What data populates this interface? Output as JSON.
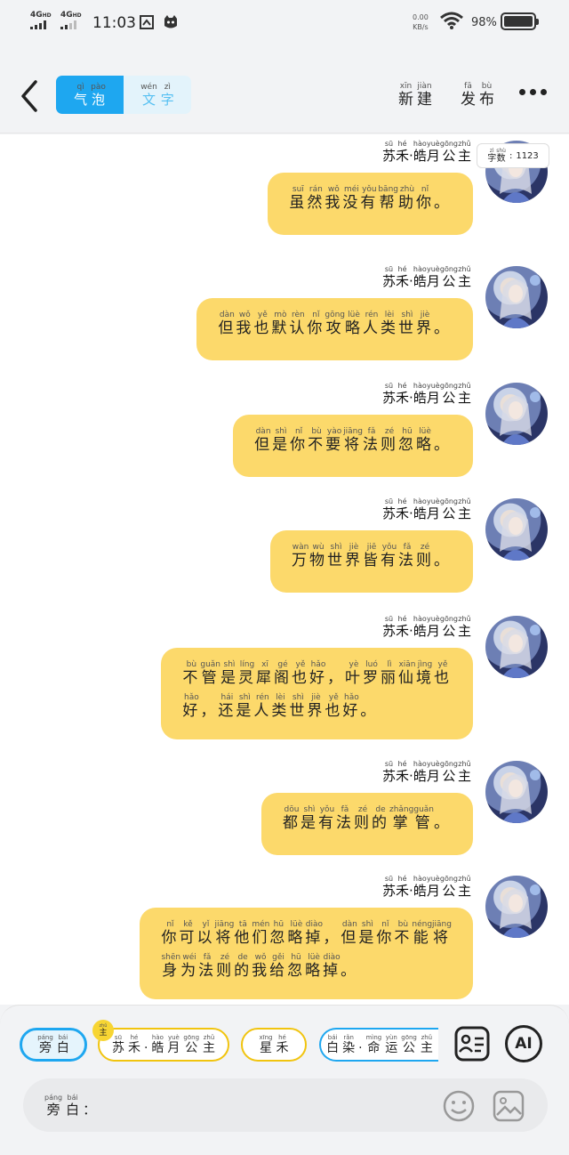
{
  "status": {
    "net1": "4G",
    "net2": "4G",
    "time": "11:03",
    "speed_value": "0.00",
    "speed_unit": "KB/s",
    "battery": "98%"
  },
  "header": {
    "tab_bubble": {
      "text": "气泡",
      "pinyin": [
        "qì",
        "pào"
      ]
    },
    "tab_text": {
      "text": "文字",
      "pinyin": [
        "wén",
        "zì"
      ]
    },
    "new_button": {
      "text": "新建",
      "pinyin": [
        "xīn",
        "jiàn"
      ]
    },
    "publish_button": {
      "text": "发布",
      "pinyin": [
        "fā",
        "bù"
      ]
    }
  },
  "word_count": {
    "label_chars": [
      "字",
      "数"
    ],
    "label_pinyin": [
      "zì",
      "shù"
    ],
    "value": "1123"
  },
  "speaker": {
    "name": [
      "苏",
      "禾",
      "·",
      "皓",
      "月",
      "公",
      "主"
    ],
    "pinyin": [
      "sū",
      "hé",
      "",
      "hào",
      "yuè",
      "gōng",
      "zhǔ"
    ]
  },
  "messages": [
    {
      "lines": [
        [
          [
            "虽",
            "suī"
          ],
          [
            "然",
            "rán"
          ],
          [
            "我",
            "wǒ"
          ],
          [
            "没",
            "méi"
          ],
          [
            "有",
            "yǒu"
          ],
          [
            "帮",
            "bāng"
          ],
          [
            "助",
            "zhù"
          ],
          [
            "你",
            "nǐ"
          ],
          [
            "。",
            ""
          ]
        ]
      ]
    },
    {
      "lines": [
        [
          [
            "但",
            "dàn"
          ],
          [
            "我",
            "wǒ"
          ],
          [
            "也",
            "yě"
          ],
          [
            "默",
            "mò"
          ],
          [
            "认",
            "rèn"
          ],
          [
            "你",
            "nǐ"
          ],
          [
            "攻",
            "gōng"
          ],
          [
            "略",
            "lüè"
          ],
          [
            "人",
            "rén"
          ],
          [
            "类",
            "lèi"
          ],
          [
            "世",
            "shì"
          ],
          [
            "界",
            "jiè"
          ],
          [
            "。",
            ""
          ]
        ]
      ]
    },
    {
      "lines": [
        [
          [
            "但",
            "dàn"
          ],
          [
            "是",
            "shì"
          ],
          [
            "你",
            "nǐ"
          ],
          [
            "不",
            "bù"
          ],
          [
            "要",
            "yào"
          ],
          [
            "将",
            "jiāng"
          ],
          [
            "法",
            "fǎ"
          ],
          [
            "则",
            "zé"
          ],
          [
            "忽",
            "hū"
          ],
          [
            "略",
            "lüè"
          ],
          [
            "。",
            ""
          ]
        ]
      ]
    },
    {
      "lines": [
        [
          [
            "万",
            "wàn"
          ],
          [
            "物",
            "wù"
          ],
          [
            "世",
            "shì"
          ],
          [
            "界",
            "jiè"
          ],
          [
            "皆",
            "jiē"
          ],
          [
            "有",
            "yǒu"
          ],
          [
            "法",
            "fǎ"
          ],
          [
            "则",
            "zé"
          ],
          [
            "。",
            ""
          ]
        ]
      ]
    },
    {
      "lines": [
        [
          [
            "不",
            "bù"
          ],
          [
            "管",
            "guǎn"
          ],
          [
            "是",
            "shì"
          ],
          [
            "灵",
            "líng"
          ],
          [
            "犀",
            "xī"
          ],
          [
            "阁",
            "gé"
          ],
          [
            "也",
            "yě"
          ],
          [
            "好",
            "hǎo"
          ],
          [
            "，",
            ""
          ],
          [
            "叶",
            "yè"
          ],
          [
            "罗",
            "luó"
          ],
          [
            "丽",
            "lì"
          ],
          [
            "仙",
            "xiān"
          ],
          [
            "境",
            "jìng"
          ],
          [
            "也",
            "yě"
          ]
        ],
        [
          [
            "好",
            "hǎo"
          ],
          [
            "，",
            ""
          ],
          [
            "还",
            "hái"
          ],
          [
            "是",
            "shì"
          ],
          [
            "人",
            "rén"
          ],
          [
            "类",
            "lèi"
          ],
          [
            "世",
            "shì"
          ],
          [
            "界",
            "jiè"
          ],
          [
            "也",
            "yě"
          ],
          [
            "好",
            "hǎo"
          ],
          [
            "。",
            ""
          ]
        ]
      ]
    },
    {
      "lines": [
        [
          [
            "都",
            "dōu"
          ],
          [
            "是",
            "shì"
          ],
          [
            "有",
            "yǒu"
          ],
          [
            "法",
            "fǎ"
          ],
          [
            "则",
            "zé"
          ],
          [
            "的",
            "de"
          ],
          [
            "掌",
            "zhǎng"
          ],
          [
            "管",
            "guǎn"
          ],
          [
            "。",
            ""
          ]
        ]
      ]
    },
    {
      "lines": [
        [
          [
            "你",
            "nǐ"
          ],
          [
            "可",
            "kě"
          ],
          [
            "以",
            "yǐ"
          ],
          [
            "将",
            "jiāng"
          ],
          [
            "他",
            "tā"
          ],
          [
            "们",
            "mén"
          ],
          [
            "忽",
            "hū"
          ],
          [
            "略",
            "lüè"
          ],
          [
            "掉",
            "diào"
          ],
          [
            "，",
            ""
          ],
          [
            "但",
            "dàn"
          ],
          [
            "是",
            "shì"
          ],
          [
            "你",
            "nǐ"
          ],
          [
            "不",
            "bù"
          ],
          [
            "能",
            "néng"
          ],
          [
            "将",
            "jiāng"
          ]
        ],
        [
          [
            "身",
            "shēn"
          ],
          [
            "为",
            "wéi"
          ],
          [
            "法",
            "fǎ"
          ],
          [
            "则",
            "zé"
          ],
          [
            "的",
            "de"
          ],
          [
            "我",
            "wǒ"
          ],
          [
            "给",
            "gěi"
          ],
          [
            "忽",
            "hū"
          ],
          [
            "略",
            "lüè"
          ],
          [
            "掉",
            "diào"
          ],
          [
            "。",
            ""
          ]
        ]
      ]
    }
  ],
  "roles": {
    "narration": [
      [
        "旁",
        "páng"
      ],
      [
        "白",
        "bái"
      ]
    ],
    "role1_badge": [
      [
        "主",
        "zhǔ"
      ]
    ],
    "role1": [
      [
        "苏",
        "sū"
      ],
      [
        "禾",
        "hé"
      ],
      [
        "·",
        ""
      ],
      [
        "皓",
        "hào"
      ],
      [
        "月",
        "yuè"
      ],
      [
        "公",
        "gōng"
      ],
      [
        "主",
        "zhǔ"
      ]
    ],
    "role2": [
      [
        "星",
        "xīng"
      ],
      [
        "禾",
        "hé"
      ]
    ],
    "role3": [
      [
        "白",
        "bái"
      ],
      [
        "染",
        "rǎn"
      ],
      [
        "·",
        ""
      ],
      [
        "命",
        "mìng"
      ],
      [
        "运",
        "yùn"
      ],
      [
        "公",
        "gōng"
      ],
      [
        "主",
        "zhǔ"
      ]
    ]
  },
  "tools": {
    "profile_icon": "id-card-icon",
    "ai_label": "AI"
  },
  "input": {
    "prefix": [
      [
        "旁",
        "páng"
      ],
      [
        "白",
        "bái"
      ],
      [
        "：",
        ""
      ]
    ]
  },
  "colors": {
    "accent": "#1ea7f0",
    "bubble": "#fcd96b",
    "role_border": "#f1c40f"
  }
}
